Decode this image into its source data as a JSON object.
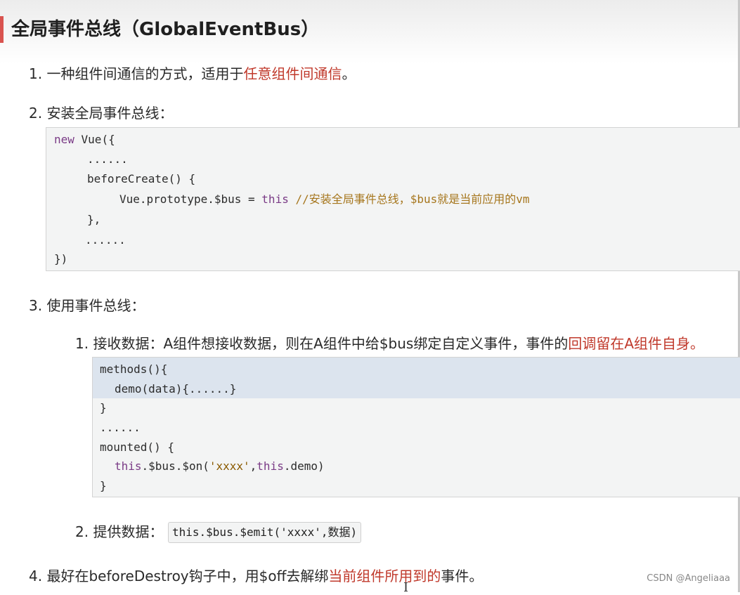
{
  "title": "全局事件总线（GlobalEventBus）",
  "item1": {
    "num": "1.",
    "pre": "一种组件间通信的方式，适用于",
    "red": "任意组件间通信",
    "post": "。"
  },
  "item2": {
    "num": "2.",
    "text": "安装全局事件总线：",
    "code": {
      "l1a": "new",
      "l1b": " Vue({",
      "l2": "......",
      "l3": "beforeCreate() {",
      "l4a": "Vue.prototype.$bus = ",
      "l4b": "this",
      "l4c": " //安装全局事件总线，$bus就是当前应用的vm",
      "l5": "},",
      "l6": "......",
      "l7": "})"
    }
  },
  "item3": {
    "num": "3.",
    "text": "使用事件总线：",
    "sub1": {
      "num": "1.",
      "pre": "接收数据：A组件想接收数据，则在A组件中给$bus绑定自定义事件，事件的",
      "red": "回调留在A组件自身。",
      "code": {
        "l1": "methods(){",
        "l2": "demo(data){......}",
        "l3": "}",
        "l4": "......",
        "l5": "mounted() {",
        "l6a": "this",
        "l6b": ".$bus.$on(",
        "l6c": "'xxxx'",
        "l6d": ",",
        "l6e": "this",
        "l6f": ".demo)",
        "l7": "}"
      }
    },
    "sub2": {
      "num": "2.",
      "text": "提供数据：",
      "code": "this.$bus.$emit('xxxx',数据)"
    }
  },
  "item4": {
    "num": "4.",
    "pre": "最好在beforeDestroy钩子中，用$off去解绑",
    "red": "当前组件所用到的",
    "post": "事件。"
  },
  "watermark": "CSDN @Angeliaaa",
  "cursor": "I"
}
